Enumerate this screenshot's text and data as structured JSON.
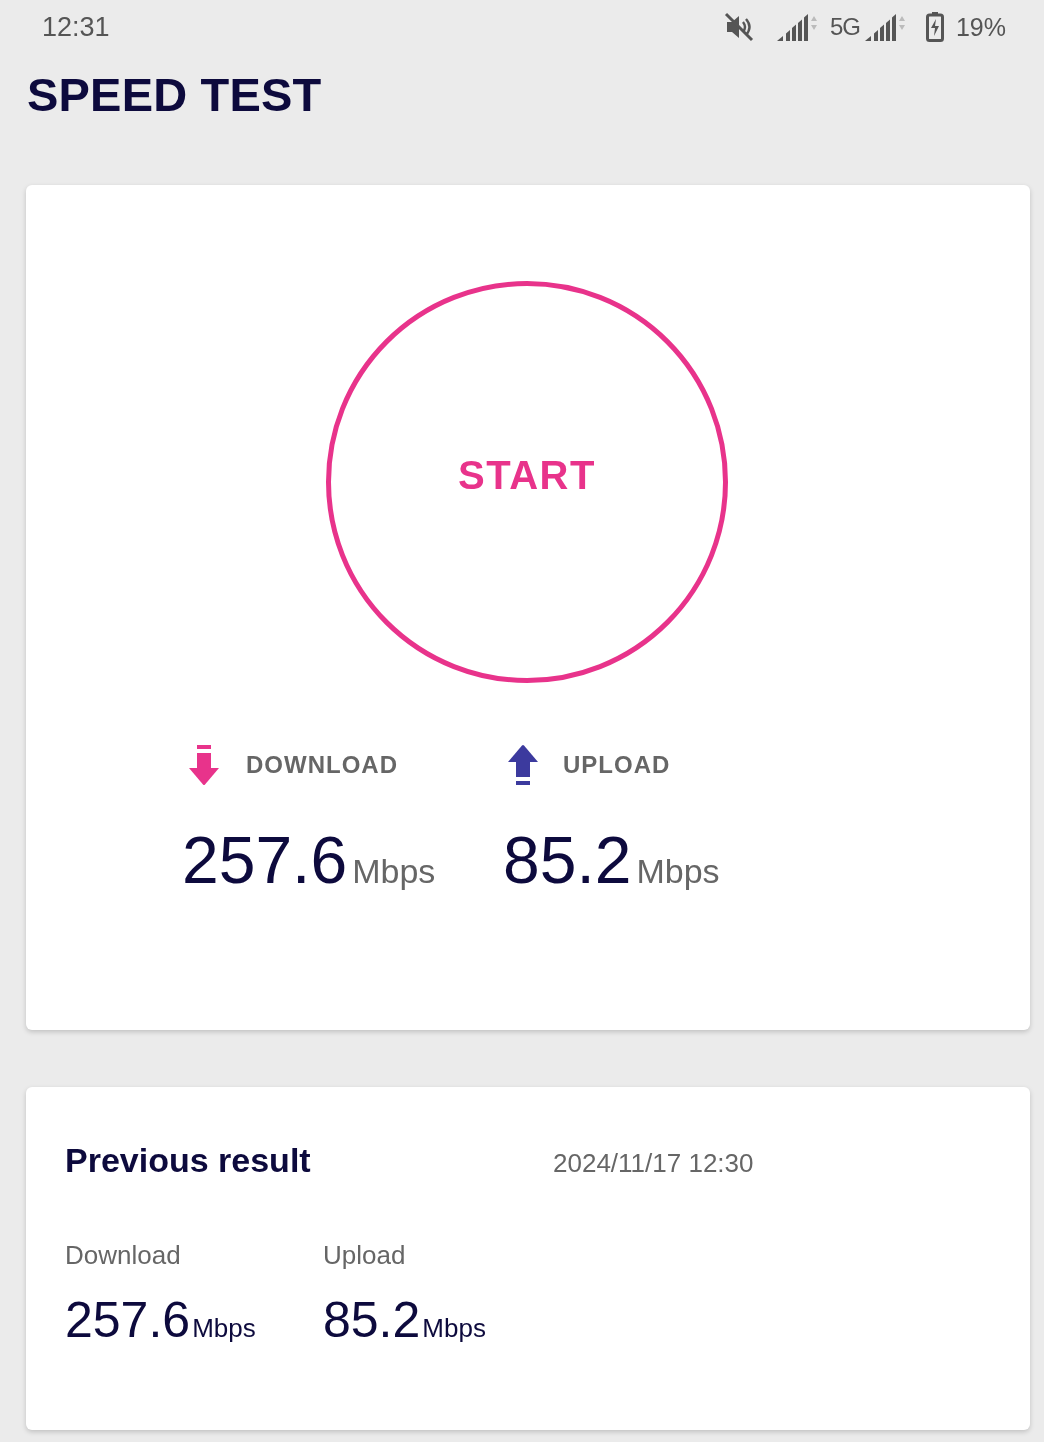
{
  "status_bar": {
    "time": "12:31",
    "network": "5G",
    "battery": "19%"
  },
  "title": "SPEED TEST",
  "test": {
    "button": "START",
    "metrics": [
      {
        "kind": "download",
        "label": "DOWNLOAD",
        "value": "257.6",
        "unit": "Mbps"
      },
      {
        "kind": "upload",
        "label": "UPLOAD",
        "value": "85.2",
        "unit": "Mbps"
      }
    ]
  },
  "previous": {
    "title": "Previous result",
    "date": "2024/11/17 12:30",
    "metrics": [
      {
        "label": "Download",
        "value": "257.6",
        "unit": "Mbps"
      },
      {
        "label": "Upload",
        "value": "85.2",
        "unit": "Mbps"
      }
    ]
  }
}
